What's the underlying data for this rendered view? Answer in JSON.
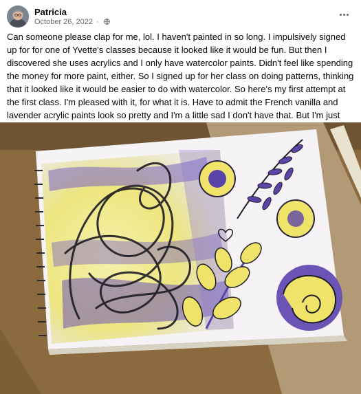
{
  "post": {
    "author": "Patricia",
    "date": "October 26, 2022",
    "separator": "·",
    "privacy_icon": "globe-icon",
    "more_icon": "ellipsis-icon",
    "text": "Can someone please clap for me, lol.  I haven't painted in so long.  I impulsively signed up for for one of Yvette's classes because it looked like it would be fun.  But then I discovered she uses acrylics and I only have watercolor paints.  Didn't feel like spending the money for more paint, either.  So I signed up for her class on doing patterns, thinking that it looked like it would be easier to do with watercolor.  So here's my first attempt at the first class.  I'm pleased with it, for what it is.  Have to admit the French vanilla and lavender acrylic paints look so pretty and I'm a little sad I don't have that.  But I'm just happy that I felt inspired to paint something, and I think it came out OK.",
    "emoji_icon": "smiley-emoji-icon"
  },
  "colors": {
    "accent_purple": "#5b44a8",
    "accent_yellow": "#efe36a",
    "secondary_text": "#65676b"
  }
}
